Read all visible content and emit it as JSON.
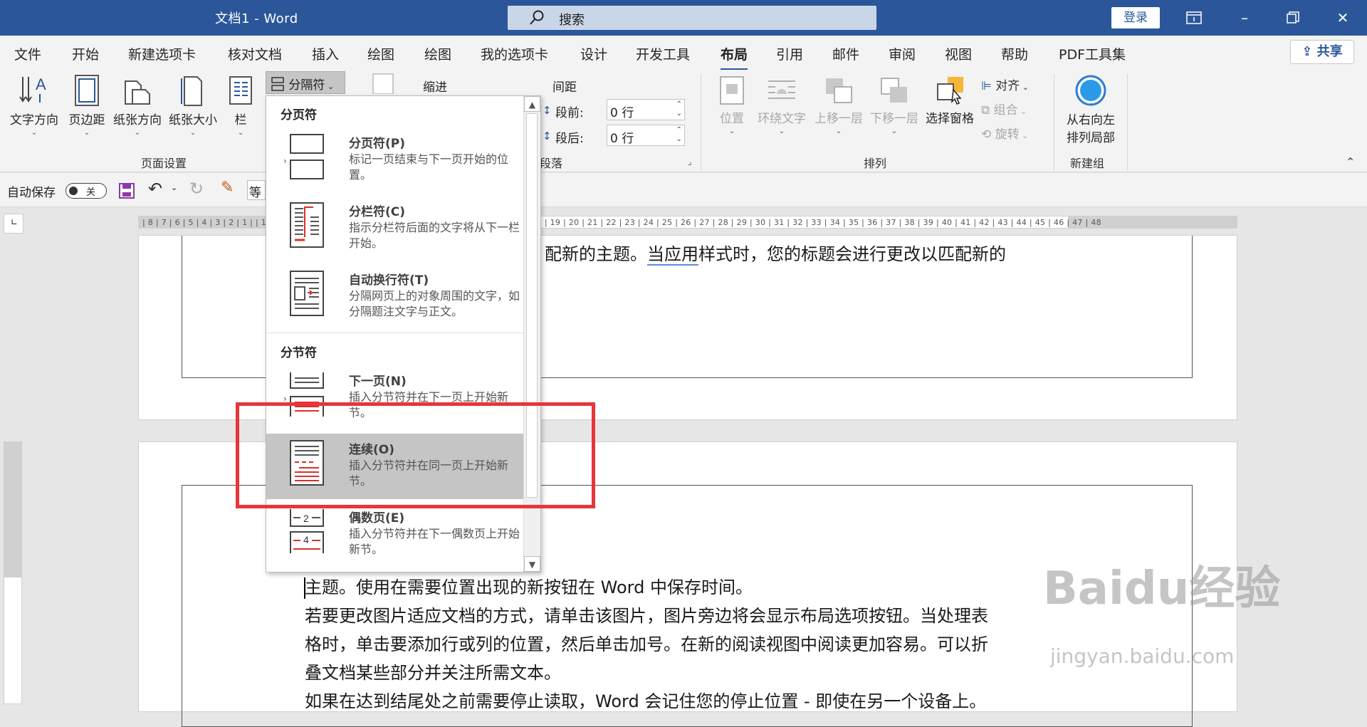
{
  "title_bar": {
    "app_title": "文档1 - Word",
    "search_placeholder": "搜索",
    "login": "登录"
  },
  "tabs": [
    "文件",
    "开始",
    "新建选项卡",
    "核对文档",
    "插入",
    "绘图",
    "绘图",
    "我的选项卡",
    "设计",
    "开发工具",
    "布局",
    "引用",
    "邮件",
    "审阅",
    "视图",
    "帮助",
    "PDF工具集"
  ],
  "active_tab": "布局",
  "share": "共享",
  "ribbon": {
    "page_setup": {
      "text_direction": "文字方向",
      "margins": "页边距",
      "orientation": "纸张方向",
      "size": "纸张大小",
      "columns": "栏",
      "breaks": "分隔符",
      "group_label": "页面设置"
    },
    "paragraph": {
      "indent": "缩进",
      "spacing": "间距",
      "before_label": "段前:",
      "before_value": "0 行",
      "after_label": "段后:",
      "after_value": "0 行",
      "group_label": "段落"
    },
    "arrange": {
      "position": "位置",
      "wrap_text": "环绕文字",
      "bring_forward": "上移一层",
      "send_backward": "下移一层",
      "selection_pane": "选择窗格",
      "align": "对齐",
      "group": "组合",
      "rotate": "旋转",
      "group_label": "排列"
    },
    "new_group": {
      "rtl_layout_line1": "从右向左",
      "rtl_layout_line2": "排列局部",
      "group_label": "新建组"
    }
  },
  "qat": {
    "autosave_label": "自动保存",
    "autosave_state": "关",
    "font_box": "等"
  },
  "ruler_numbers": "| 8 | 7 | 6 | 5 | 4 | 3 | 2 | 1 |     | 1 | 2 | 3 | 4 | 5 | 6 | 7 | 8 | 9 | 10 | 11 | 12 | 13 | 14 | 15 | 16 | 17 | 18 | 19 | 20 | 21 | 22 | 23 | 24 | 25 | 26 | 27 | 28 | 29 | 30 | 31 | 32 | 33 | 34 | 35 | 36 | 37 | 38 | 39 | 40 | 41 | 42 | 43 | 44 | 45 | 46 | 47 | 48",
  "breaks_menu": {
    "page_breaks_header": "分页符",
    "section_breaks_header": "分节符",
    "items": [
      {
        "title": "分页符(P)",
        "desc": "标记一页结束与下一页开始的位置。"
      },
      {
        "title": "分栏符(C)",
        "desc": "指示分栏符后面的文字将从下一栏开始。"
      },
      {
        "title": "自动换行符(T)",
        "desc": "分隔网页上的对象周围的文字，如分隔题注文字与正文。"
      },
      {
        "title": "下一页(N)",
        "desc": "插入分节符并在下一页上开始新节。"
      },
      {
        "title": "连续(O)",
        "desc": "插入分节符并在同一页上开始新节。"
      },
      {
        "title": "偶数页(E)",
        "desc": "插入分节符并在下一偶数页上开始新节。"
      }
    ]
  },
  "document": {
    "page1_line_a": "配新的主题。",
    "page1_line_b": "当应用",
    "page1_line_c": "样式时，您的标题会进行更改以匹配新的",
    "page2_lines": [
      "主题。使用在需要位置出现的新按钮在 Word 中保存时间。",
      "若要更改图片适应文档的方式，请单击该图片，图片旁边将会显示布局选项按钮。当处理表",
      "格时，单击要添加行或列的位置，然后单击加号。在新的阅读视图中阅读更加容易。可以折",
      "叠文档某些部分并关注所需文本。",
      "如果在达到结尾处之前需要停止读取，Word 会记住您的停止位置 - 即使在另一个设备上。"
    ]
  },
  "watermark": {
    "brand": "Baidu经验",
    "url": "jingyan.baidu.com"
  }
}
